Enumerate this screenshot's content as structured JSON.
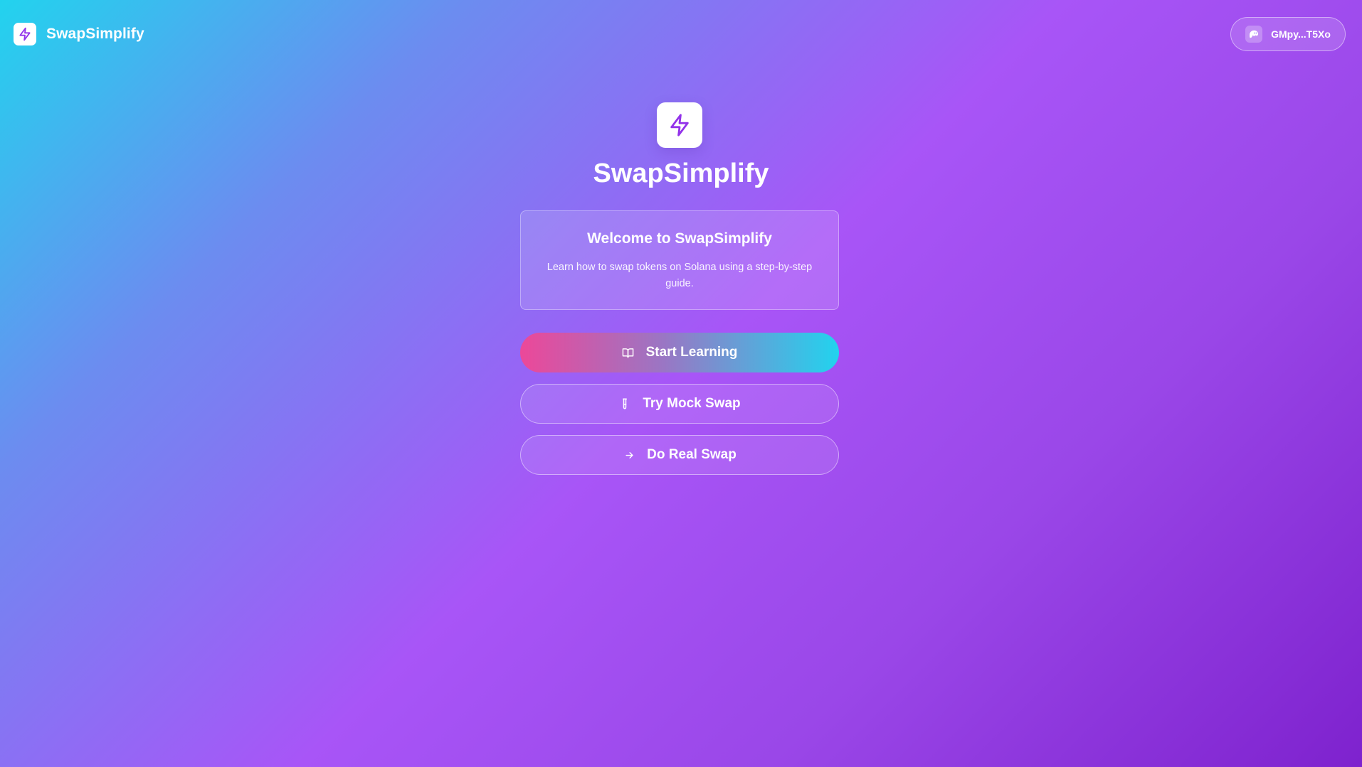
{
  "header": {
    "brand_name": "SwapSimplify",
    "brand_icon": "lightning-bolt-icon",
    "wallet": {
      "icon": "phantom-ghost-icon",
      "address": "GMpy...T5Xo"
    }
  },
  "hero": {
    "icon": "lightning-bolt-icon",
    "title": "SwapSimplify"
  },
  "welcome": {
    "title": "Welcome to SwapSimplify",
    "description": "Learn how to swap tokens on Solana using a step-by-step guide."
  },
  "actions": {
    "start_learning": {
      "label": "Start Learning",
      "icon": "book-open-icon"
    },
    "mock_swap": {
      "label": "Try Mock Swap",
      "icon": "flask-icon"
    },
    "real_swap": {
      "label": "Do Real Swap",
      "icon": "arrow-right-icon"
    }
  },
  "colors": {
    "brand_purple": "#9333ea",
    "gradient_start": "#22d3ee",
    "gradient_mid": "#a855f7",
    "gradient_end": "#7e22ce",
    "primary_button_start": "#ec4899",
    "primary_button_end": "#22d3ee"
  }
}
